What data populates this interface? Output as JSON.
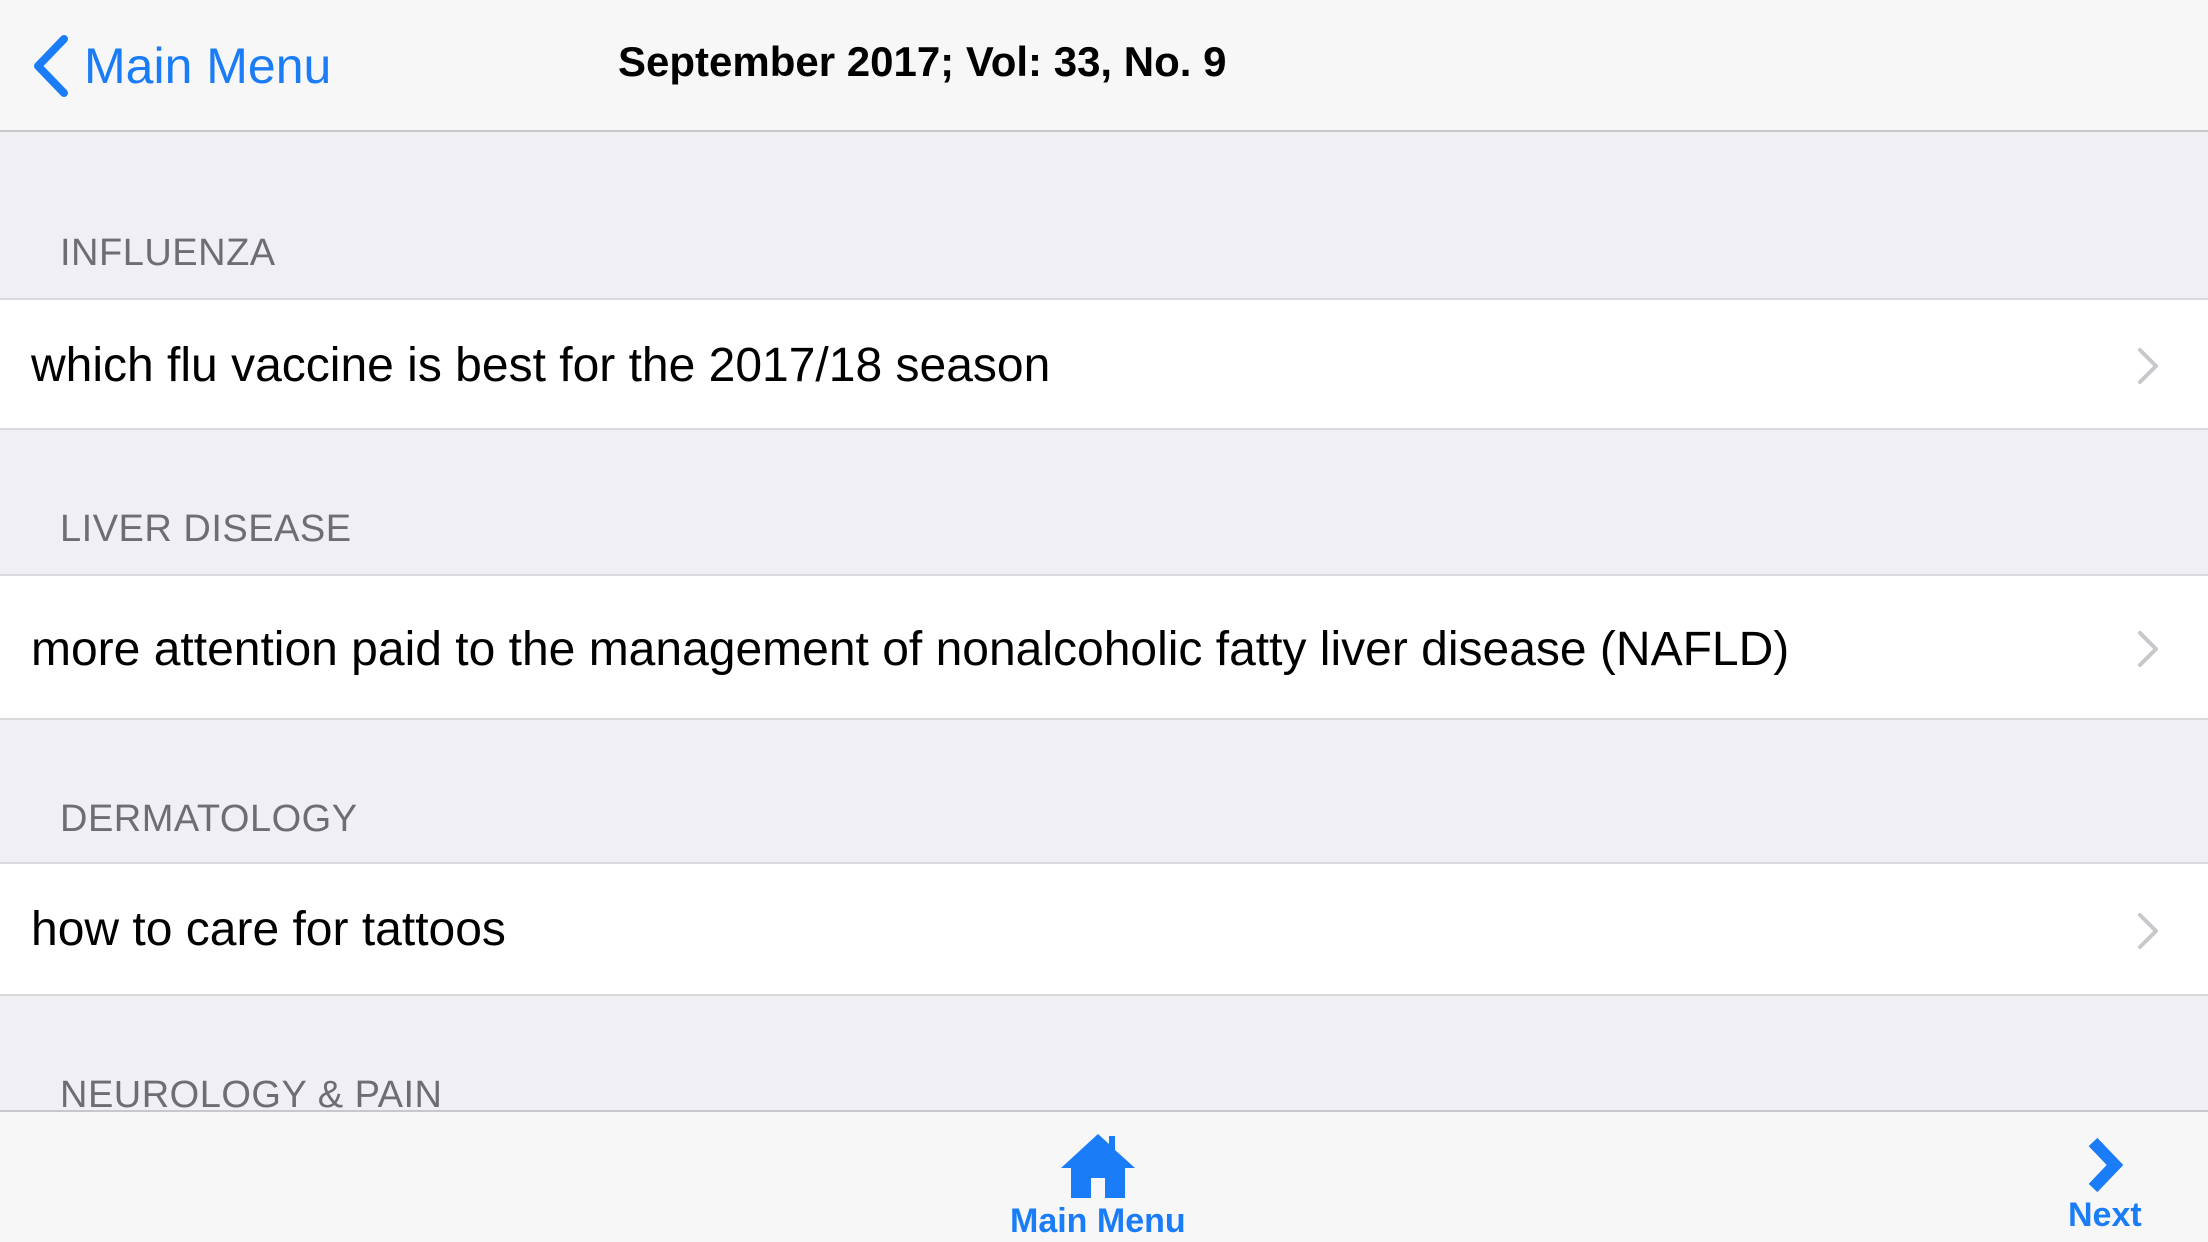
{
  "navbar": {
    "back_label": "Main Menu",
    "title": "September 2017; Vol: 33, No. 9"
  },
  "sections": [
    {
      "header": "INFLUENZA",
      "item": "which flu vaccine is best for the 2017/18 season"
    },
    {
      "header": "LIVER DISEASE",
      "item": "more attention paid to the management of nonalcoholic fatty liver disease (NAFLD)"
    },
    {
      "header": "DERMATOLOGY",
      "item": "how to care for tattoos"
    },
    {
      "header": "NEUROLOGY & PAIN"
    }
  ],
  "toolbar": {
    "home_label": "Main Menu",
    "home_icon": "house-icon",
    "next_label": "Next",
    "next_icon": "chevron-right-icon"
  },
  "colors": {
    "accent": "#1a7cf6",
    "background": "#efeff4",
    "section_text": "#6d6d72"
  }
}
